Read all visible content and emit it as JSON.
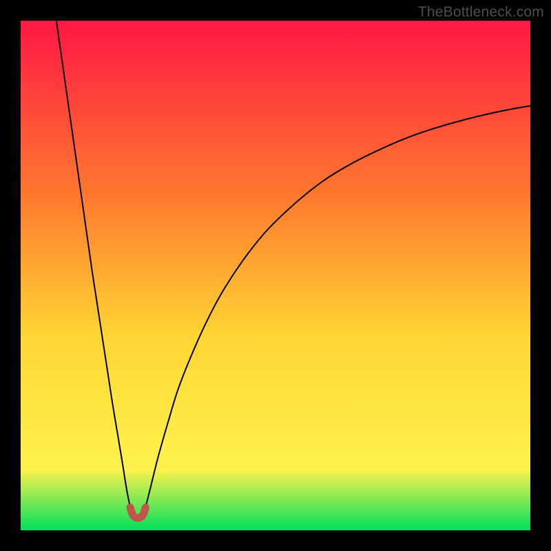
{
  "watermark": "TheBottleneck.com",
  "chart_data": {
    "type": "line",
    "title": "",
    "xlabel": "",
    "ylabel": "",
    "xlim": [
      0,
      100
    ],
    "ylim": [
      0,
      100
    ],
    "grid": false,
    "legend": false,
    "gradient_colors": {
      "top": "#ff1744",
      "mid1": "#ff7b2e",
      "mid2": "#ffd633",
      "mid3": "#fff24d",
      "bottom": "#00e05a"
    },
    "series": [
      {
        "name": "left-branch",
        "stroke": "#000000",
        "stroke_width": 2,
        "points": [
          {
            "x": 7.0,
            "y": 100.0
          },
          {
            "x": 8.0,
            "y": 93.0
          },
          {
            "x": 9.0,
            "y": 86.0
          },
          {
            "x": 10.0,
            "y": 79.0
          },
          {
            "x": 11.0,
            "y": 72.0
          },
          {
            "x": 12.0,
            "y": 65.0
          },
          {
            "x": 13.0,
            "y": 58.0
          },
          {
            "x": 14.0,
            "y": 51.0
          },
          {
            "x": 15.0,
            "y": 44.5
          },
          {
            "x": 16.0,
            "y": 38.0
          },
          {
            "x": 17.0,
            "y": 31.5
          },
          {
            "x": 18.0,
            "y": 25.0
          },
          {
            "x": 19.0,
            "y": 19.0
          },
          {
            "x": 20.0,
            "y": 13.0
          },
          {
            "x": 20.8,
            "y": 8.0
          },
          {
            "x": 21.5,
            "y": 4.5
          }
        ]
      },
      {
        "name": "right-branch",
        "stroke": "#000000",
        "stroke_width": 2,
        "points": [
          {
            "x": 24.5,
            "y": 4.5
          },
          {
            "x": 25.5,
            "y": 8.5
          },
          {
            "x": 27.0,
            "y": 14.5
          },
          {
            "x": 29.0,
            "y": 21.5
          },
          {
            "x": 31.0,
            "y": 28.0
          },
          {
            "x": 34.0,
            "y": 35.5
          },
          {
            "x": 37.0,
            "y": 42.0
          },
          {
            "x": 40.0,
            "y": 47.5
          },
          {
            "x": 44.0,
            "y": 53.5
          },
          {
            "x": 48.0,
            "y": 58.5
          },
          {
            "x": 52.0,
            "y": 62.5
          },
          {
            "x": 56.0,
            "y": 66.0
          },
          {
            "x": 60.0,
            "y": 69.0
          },
          {
            "x": 65.0,
            "y": 72.0
          },
          {
            "x": 70.0,
            "y": 74.5
          },
          {
            "x": 75.0,
            "y": 76.7
          },
          {
            "x": 80.0,
            "y": 78.5
          },
          {
            "x": 85.0,
            "y": 80.0
          },
          {
            "x": 90.0,
            "y": 81.3
          },
          {
            "x": 95.0,
            "y": 82.4
          },
          {
            "x": 100.0,
            "y": 83.3
          }
        ]
      },
      {
        "name": "valley-marker",
        "stroke": "#c1554d",
        "stroke_width": 11,
        "linecap": "round",
        "points": [
          {
            "x": 21.5,
            "y": 4.5
          },
          {
            "x": 21.9,
            "y": 3.2
          },
          {
            "x": 22.4,
            "y": 2.6
          },
          {
            "x": 23.0,
            "y": 2.4
          },
          {
            "x": 23.6,
            "y": 2.6
          },
          {
            "x": 24.1,
            "y": 3.2
          },
          {
            "x": 24.5,
            "y": 4.5
          }
        ]
      }
    ]
  }
}
